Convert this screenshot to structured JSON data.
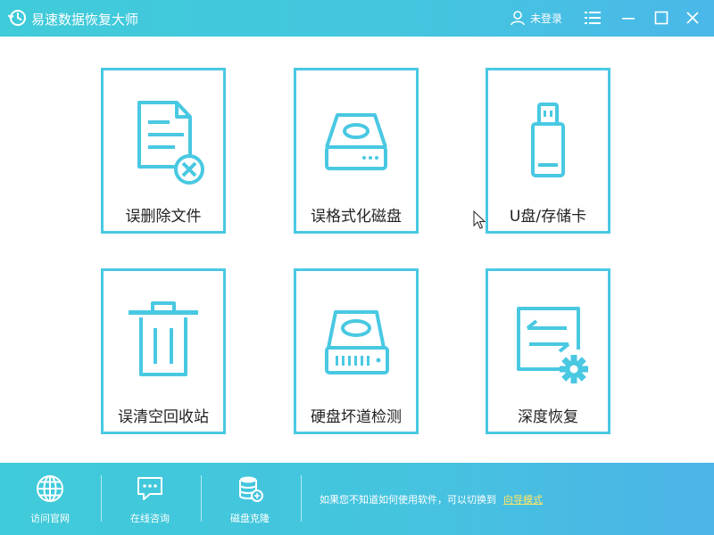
{
  "window": {
    "title": "易速数据恢复大师",
    "user_label": "未登录",
    "accent_color": "#49c8e2",
    "controls": [
      "menu-icon",
      "minimize-icon",
      "maximize-icon",
      "close-icon"
    ]
  },
  "tiles": [
    {
      "label": "误删除文件",
      "icon": "deleted-file-icon"
    },
    {
      "label": "误格式化磁盘",
      "icon": "hard-disk-icon"
    },
    {
      "label": "U盘/存储卡",
      "icon": "usb-drive-icon"
    },
    {
      "label": "误清空回收站",
      "icon": "recycle-bin-icon"
    },
    {
      "label": "硬盘坏道检测",
      "icon": "disk-check-icon"
    },
    {
      "label": "深度恢复",
      "icon": "deep-recovery-icon"
    }
  ],
  "footer": {
    "buttons": [
      {
        "label": "访问官网",
        "icon": "globe-icon"
      },
      {
        "label": "在线咨询",
        "icon": "chat-icon"
      },
      {
        "label": "磁盘克隆",
        "icon": "disk-clone-icon"
      }
    ],
    "hint_text": "如果您不知道如何使用软件，可以切换到",
    "wizard_link": "向导模式"
  }
}
